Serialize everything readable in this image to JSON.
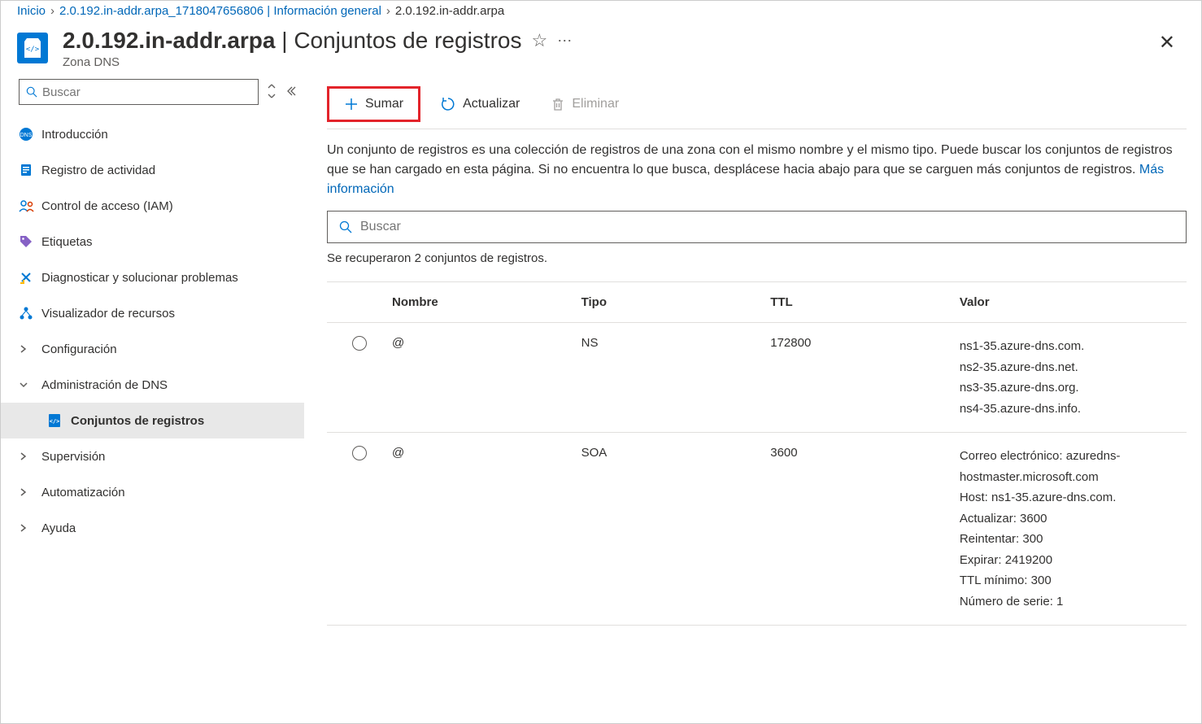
{
  "breadcrumb": {
    "home": "Inicio",
    "mid": "2.0.192.in-addr.arpa_1718047656806 | Información general",
    "last": "2.0.192.in-addr.arpa"
  },
  "header": {
    "title_left": "2.0.192.in-addr.arpa",
    "title_right": "Conjuntos de registros",
    "subtitle": "Zona DNS"
  },
  "sidebar": {
    "search_placeholder": "Buscar",
    "items": [
      {
        "label": "Introducción",
        "icon": "dns-circle"
      },
      {
        "label": "Registro de actividad",
        "icon": "log"
      },
      {
        "label": "Control de acceso (IAM)",
        "icon": "iam"
      },
      {
        "label": "Etiquetas",
        "icon": "tag"
      },
      {
        "label": "Diagnosticar y solucionar problemas",
        "icon": "diagnose"
      },
      {
        "label": "Visualizador de recursos",
        "icon": "resource"
      },
      {
        "label": "Configuración",
        "chev": "right"
      },
      {
        "label": "Administración de DNS",
        "chev": "down"
      },
      {
        "label": "Conjuntos de registros",
        "icon": "dns-doc",
        "indent": true,
        "active": true
      },
      {
        "label": "Supervisión",
        "chev": "right"
      },
      {
        "label": "Automatización",
        "chev": "right"
      },
      {
        "label": "Ayuda",
        "chev": "right"
      }
    ]
  },
  "toolbar": {
    "add": "Sumar",
    "refresh": "Actualizar",
    "delete": "Eliminar"
  },
  "main": {
    "description": "Un conjunto de registros es una colección de registros de una zona con el mismo nombre y el mismo tipo. Puede buscar los conjuntos de registros que se han cargado en esta página. Si no encuentra lo que busca, desplácese hacia abajo para que se carguen más conjuntos de registros. ",
    "more_info": "Más información",
    "search_placeholder": "Buscar",
    "status": "Se recuperaron 2 conjuntos de registros."
  },
  "table": {
    "headers": {
      "name": "Nombre",
      "type": "Tipo",
      "ttl": "TTL",
      "value": "Valor"
    },
    "rows": [
      {
        "name": "@",
        "type": "NS",
        "ttl": "172800",
        "values": [
          "ns1-35.azure-dns.com.",
          "ns2-35.azure-dns.net.",
          "ns3-35.azure-dns.org.",
          "ns4-35.azure-dns.info."
        ]
      },
      {
        "name": "@",
        "type": "SOA",
        "ttl": "3600",
        "values": [
          "Correo electrónico: azuredns-hostmaster.microsoft.com",
          "Host: ns1-35.azure-dns.com.",
          "Actualizar: 3600",
          "Reintentar: 300",
          "Expirar: 2419200",
          "TTL mínimo: 300",
          "Número de serie: 1"
        ]
      }
    ]
  }
}
